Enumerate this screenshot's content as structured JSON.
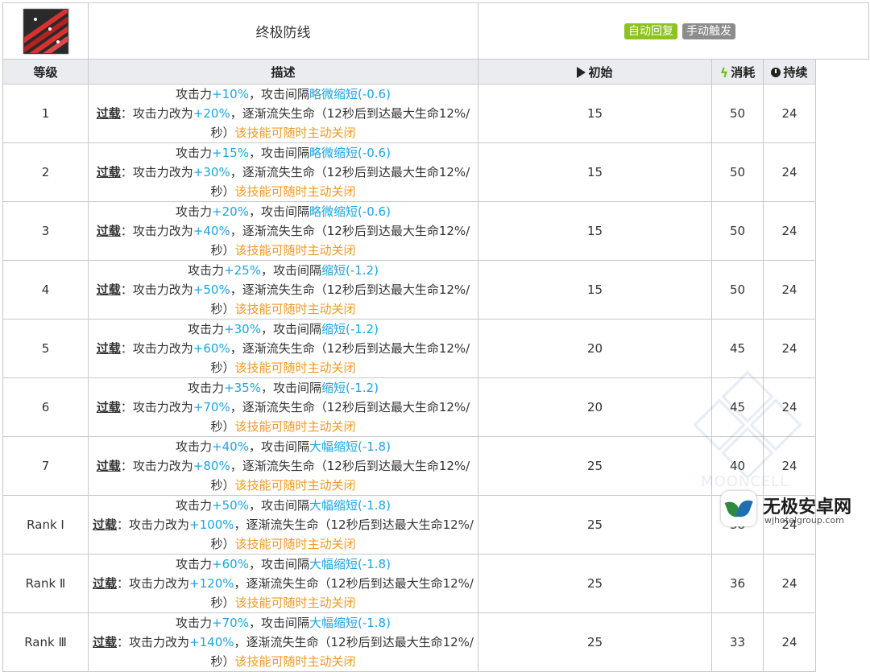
{
  "skill": {
    "name": "终极防线",
    "tags": {
      "auto": "自动回复",
      "manual": "手动触发"
    },
    "icon": "skill-icon-red-stripes"
  },
  "headers": {
    "level": "等级",
    "desc": "描述",
    "initial": "初始",
    "cost": "消耗",
    "duration": "持续"
  },
  "header_icons": {
    "initial": "play-icon",
    "cost": "lightning-icon",
    "duration": "clock-icon"
  },
  "text": {
    "atk_prefix": "攻击力",
    "interval_mid": "，攻击间隔",
    "overload": "过载",
    "line2_prefix": "：攻击力改为",
    "line2_mid": "，逐渐流失生命（12秒后到达最大生命12%/秒）",
    "line2_suffix": "该技能可随时主动关闭"
  },
  "rows": [
    {
      "level": "1",
      "atk": "+10%",
      "interval": "略微缩短(-0.6)",
      "overload_atk": "+20%",
      "initial": "15",
      "cost": "50",
      "duration": "24"
    },
    {
      "level": "2",
      "atk": "+15%",
      "interval": "略微缩短(-0.6)",
      "overload_atk": "+30%",
      "initial": "15",
      "cost": "50",
      "duration": "24"
    },
    {
      "level": "3",
      "atk": "+20%",
      "interval": "略微缩短(-0.6)",
      "overload_atk": "+40%",
      "initial": "15",
      "cost": "50",
      "duration": "24"
    },
    {
      "level": "4",
      "atk": "+25%",
      "interval": "缩短(-1.2)",
      "overload_atk": "+50%",
      "initial": "15",
      "cost": "50",
      "duration": "24"
    },
    {
      "level": "5",
      "atk": "+30%",
      "interval": "缩短(-1.2)",
      "overload_atk": "+60%",
      "initial": "20",
      "cost": "45",
      "duration": "24"
    },
    {
      "level": "6",
      "atk": "+35%",
      "interval": "缩短(-1.2)",
      "overload_atk": "+70%",
      "initial": "20",
      "cost": "45",
      "duration": "24"
    },
    {
      "level": "7",
      "atk": "+40%",
      "interval": "大幅缩短(-1.8)",
      "overload_atk": "+80%",
      "initial": "25",
      "cost": "40",
      "duration": "24"
    },
    {
      "level": "Rank Ⅰ",
      "atk": "+50%",
      "interval": "大幅缩短(-1.8)",
      "overload_atk": "+100%",
      "initial": "25",
      "cost": "38",
      "duration": "24"
    },
    {
      "level": "Rank Ⅱ",
      "atk": "+60%",
      "interval": "大幅缩短(-1.8)",
      "overload_atk": "+120%",
      "initial": "25",
      "cost": "36",
      "duration": "24"
    },
    {
      "level": "Rank Ⅲ",
      "atk": "+70%",
      "interval": "大幅缩短(-1.8)",
      "overload_atk": "+140%",
      "initial": "25",
      "cost": "33",
      "duration": "24"
    }
  ],
  "watermark": "MOONCELL",
  "brand": {
    "name": "无极安卓网",
    "url": "wjhotelgroup.com"
  },
  "colors": {
    "blue": "#1ea4e1",
    "orange": "#f09a22",
    "tag_auto": "#8dc21f",
    "tag_manual": "#8c8c8c",
    "header_bg": "#eaecf0"
  }
}
